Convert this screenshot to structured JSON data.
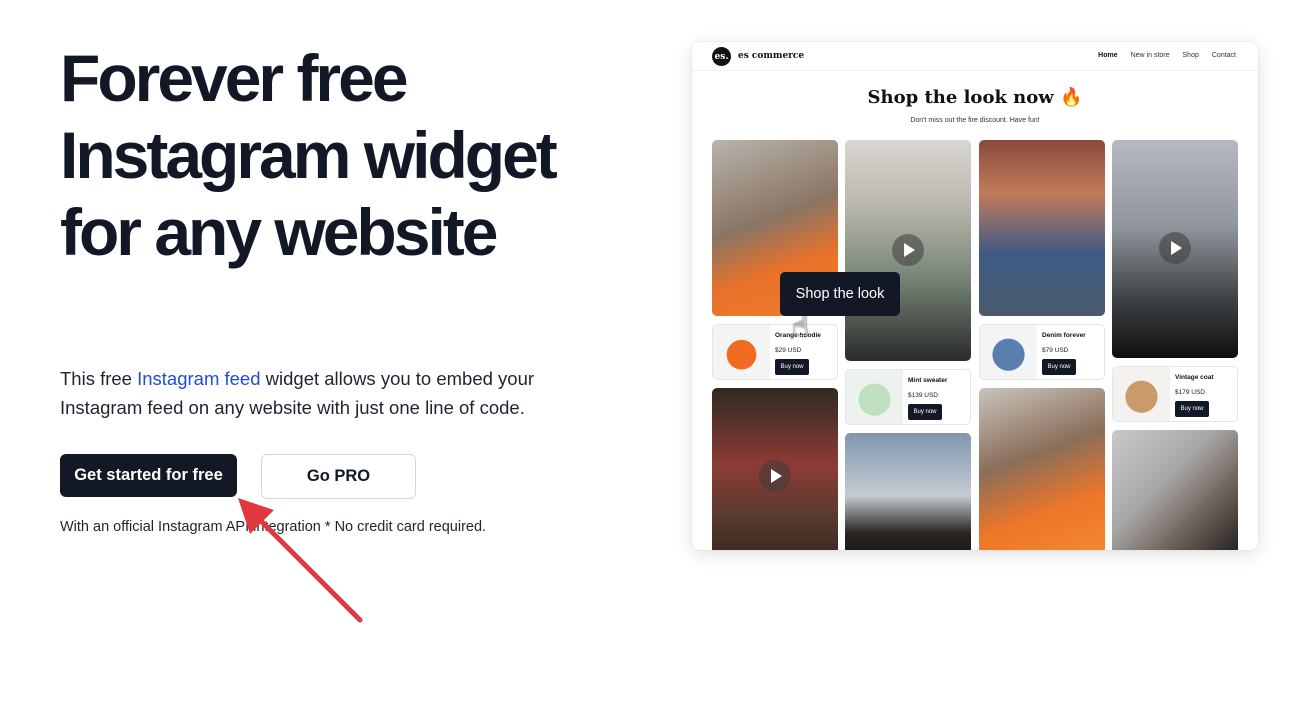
{
  "hero": {
    "title": "Forever free Instagram widget for any website",
    "desc_before": "This free ",
    "desc_link": "Instagram feed",
    "desc_after": " widget allows you to embed your Instagram feed on any website with just one line of code.",
    "primary_button": "Get started for free",
    "secondary_button": "Go PRO",
    "note": "With an official Instagram API integration * No credit card required."
  },
  "preview": {
    "logo_text": "es.",
    "brand": "es commerce",
    "nav": [
      "Home",
      "New in store",
      "Shop",
      "Contact"
    ],
    "title": "Shop the look now 🔥",
    "subtitle": "Don't miss out the fire discount. Have fun!",
    "tooltip": "Shop the look",
    "products": [
      {
        "name": "Orange hoodie",
        "price": "$29 USD",
        "button": "Buy now"
      },
      {
        "name": "Mint sweater",
        "price": "$139 USD",
        "button": "Buy now"
      },
      {
        "name": "Denim forever",
        "price": "$79 USD",
        "button": "Buy now"
      },
      {
        "name": "Vintage coat",
        "price": "$179 USD",
        "button": "Buy now"
      }
    ]
  },
  "colors": {
    "primary": "#121826",
    "link": "#1d4ed8",
    "arrow": "#e0383e"
  }
}
